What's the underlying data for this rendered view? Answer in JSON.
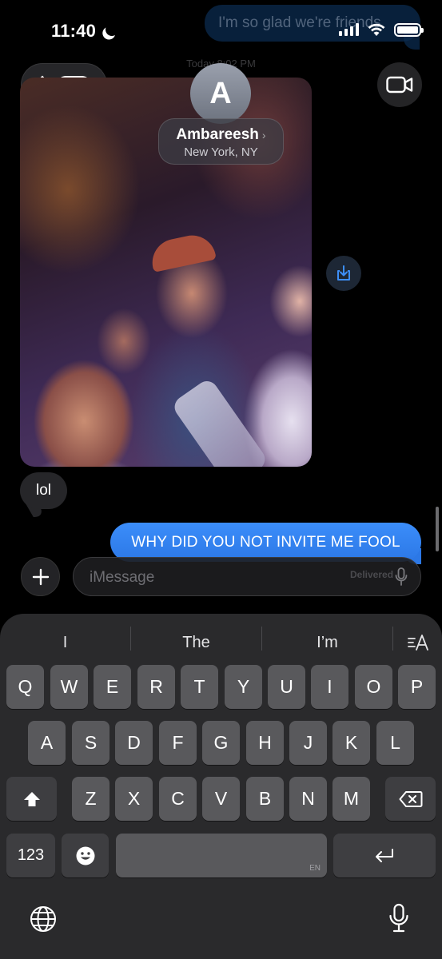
{
  "status": {
    "time": "11:40"
  },
  "background_message": {
    "text": "I'm so glad we're friends",
    "date": "Today 8:02 PM"
  },
  "header": {
    "back_count": "890",
    "avatar_initial": "A",
    "contact_name": "Ambareesh",
    "contact_location": "New York, NY"
  },
  "messages": [
    {
      "direction": "incoming",
      "type": "photo"
    },
    {
      "direction": "incoming",
      "text": "lol"
    },
    {
      "direction": "outgoing",
      "text": "WHY DID YOU NOT INVITE ME FOOL",
      "status": "Delivered"
    }
  ],
  "composer": {
    "placeholder": "iMessage"
  },
  "keyboard": {
    "suggestions": [
      "I",
      "The",
      "I’m"
    ],
    "row1": [
      "Q",
      "W",
      "E",
      "R",
      "T",
      "Y",
      "U",
      "I",
      "O",
      "P"
    ],
    "row2": [
      "A",
      "S",
      "D",
      "F",
      "G",
      "H",
      "J",
      "K",
      "L"
    ],
    "row3": [
      "Z",
      "X",
      "C",
      "V",
      "B",
      "N",
      "M"
    ],
    "numbers_label": "123",
    "space_language": "EN"
  },
  "colors": {
    "outgoing_bubble": "#2c78e6",
    "incoming_bubble": "#262629",
    "keyboard_bg": "#2a2a2c",
    "key_bg": "#59595c"
  }
}
